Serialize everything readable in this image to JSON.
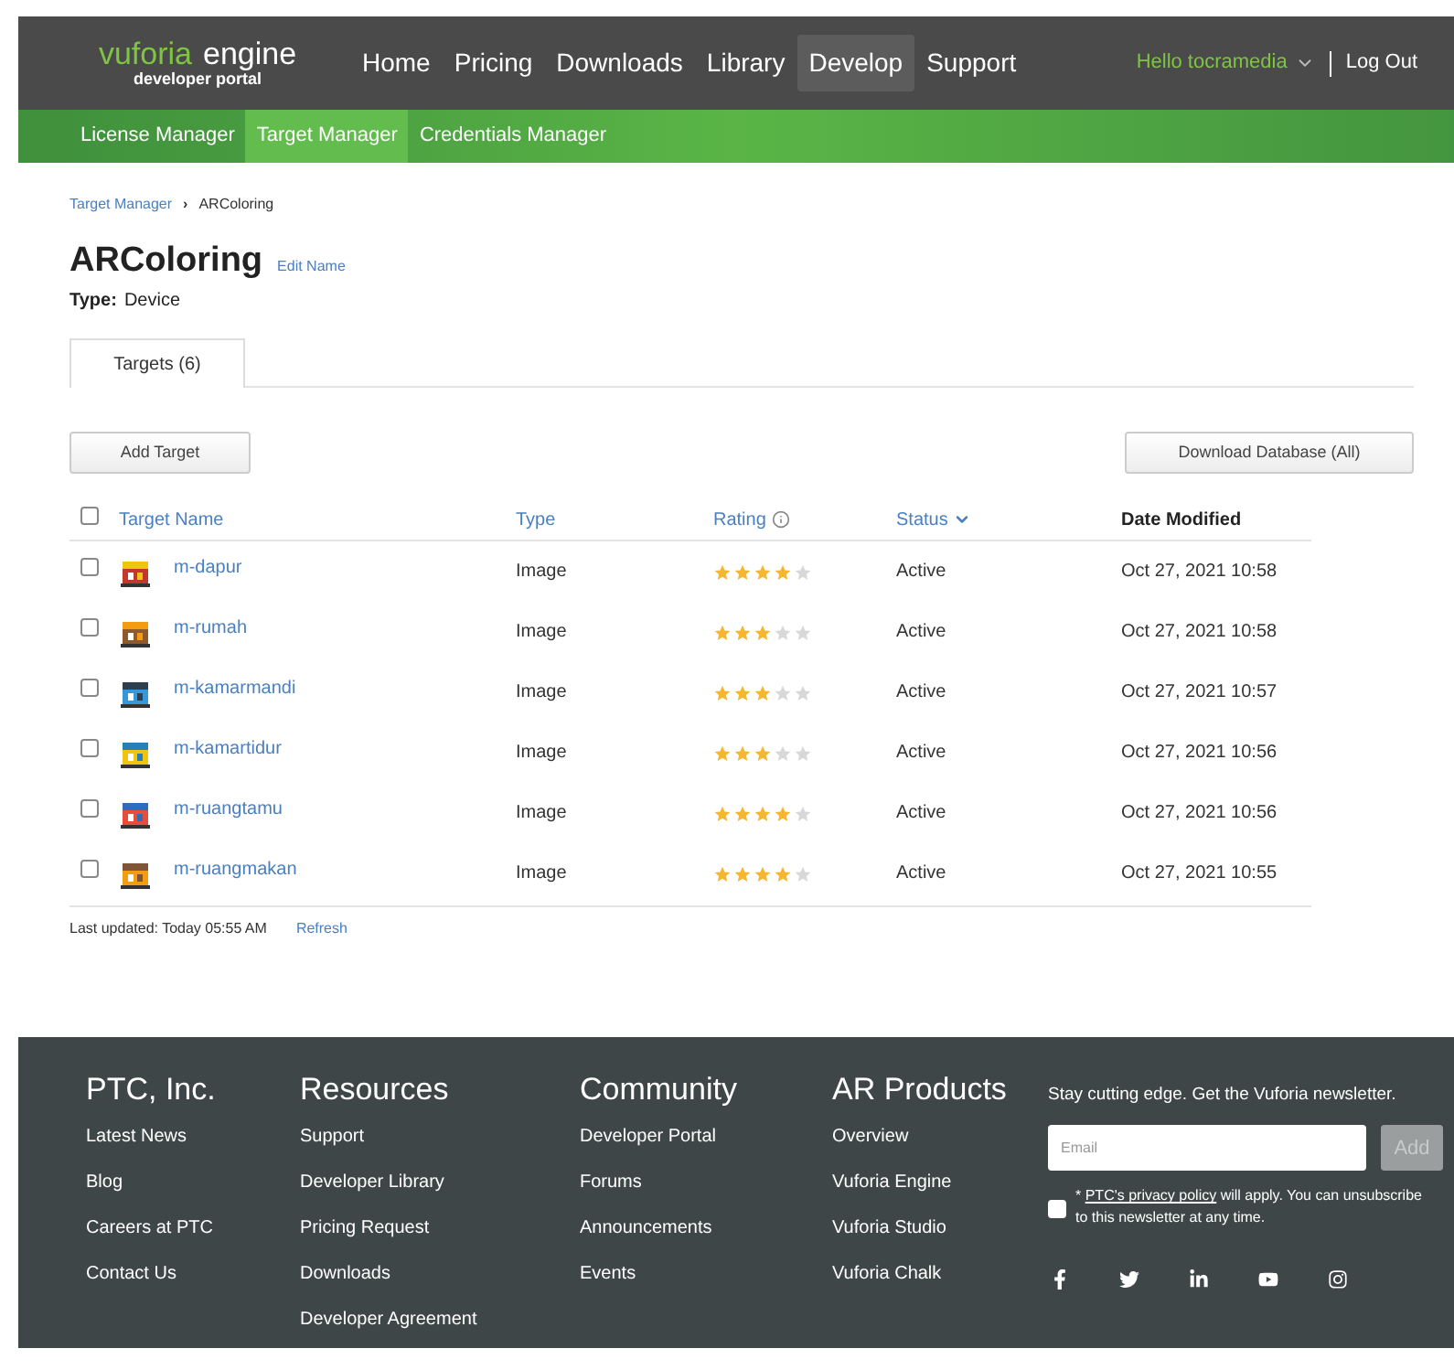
{
  "logo": {
    "word1": "vuforia",
    "word2": "engine",
    "subtitle": "developer portal"
  },
  "nav": [
    {
      "label": "Home",
      "selected": false
    },
    {
      "label": "Pricing",
      "selected": false
    },
    {
      "label": "Downloads",
      "selected": false
    },
    {
      "label": "Library",
      "selected": false
    },
    {
      "label": "Develop",
      "selected": true
    },
    {
      "label": "Support",
      "selected": false
    }
  ],
  "user": {
    "greeting": "Hello tocramedia",
    "logout": "Log Out"
  },
  "subnav": [
    {
      "label": "License Manager",
      "selected": false
    },
    {
      "label": "Target Manager",
      "selected": true
    },
    {
      "label": "Credentials Manager",
      "selected": false
    }
  ],
  "breadcrumb": {
    "link": "Target Manager",
    "separator": "›",
    "current": "ARColoring"
  },
  "database": {
    "name": "ARColoring",
    "edit": "Edit Name",
    "type_label": "Type:",
    "type": "Device"
  },
  "tabs": [
    {
      "label": "Targets (6)",
      "selected": true
    }
  ],
  "buttons": {
    "add": "Add Target",
    "download": "Download Database (All)"
  },
  "table": {
    "columns": [
      {
        "label": "Target Name",
        "kind": "link"
      },
      {
        "label": "Type",
        "kind": "link"
      },
      {
        "label": "Rating",
        "kind": "info"
      },
      {
        "label": "Status",
        "kind": "sort"
      },
      {
        "label": "Date Modified",
        "kind": "plain"
      }
    ],
    "rows": [
      {
        "checked": false,
        "name": "m-dapur",
        "type": "Image",
        "stars": 4,
        "status": "Active",
        "date": "Oct 27, 2021 10:58"
      },
      {
        "checked": false,
        "name": "m-rumah",
        "type": "Image",
        "stars": 3,
        "status": "Active",
        "date": "Oct 27, 2021 10:58"
      },
      {
        "checked": false,
        "name": "m-kamarmandi",
        "type": "Image",
        "stars": 3,
        "status": "Active",
        "date": "Oct 27, 2021 10:57"
      },
      {
        "checked": false,
        "name": "m-kamartidur",
        "type": "Image",
        "stars": 3,
        "status": "Active",
        "date": "Oct 27, 2021 10:56"
      },
      {
        "checked": false,
        "name": "m-ruangtamu",
        "type": "Image",
        "stars": 4,
        "status": "Active",
        "date": "Oct 27, 2021 10:56"
      },
      {
        "checked": false,
        "name": "m-ruangmakan",
        "type": "Image",
        "stars": 4,
        "status": "Active",
        "date": "Oct 27, 2021 10:55"
      }
    ],
    "all_checked": false
  },
  "updated": {
    "text": "Last updated: Today 05:55 AM",
    "refresh": "Refresh"
  },
  "footer": {
    "columns": [
      {
        "title": "PTC, Inc.",
        "links": [
          "Latest News",
          "Blog",
          "Careers at PTC",
          "Contact Us"
        ]
      },
      {
        "title": "Resources",
        "links": [
          "Support",
          "Developer Library",
          "Pricing Request",
          "Downloads",
          "Developer Agreement"
        ]
      },
      {
        "title": "Community",
        "links": [
          "Developer Portal",
          "Forums",
          "Announcements",
          "Events"
        ]
      },
      {
        "title": "AR Products",
        "links": [
          "Overview",
          "Vuforia Engine",
          "Vuforia Studio",
          "Vuforia Chalk"
        ]
      }
    ],
    "newsletter": {
      "heading": "Stay cutting edge. Get the Vuforia newsletter.",
      "placeholder": "Email",
      "button": "Add",
      "checked": false,
      "prefix": "* ",
      "policy": "PTC's privacy policy",
      "suffix": " will apply. You can unsubscribe to this newsletter at any time."
    },
    "social": [
      {
        "kind": "facebook"
      },
      {
        "kind": "twitter"
      },
      {
        "kind": "linkedin"
      },
      {
        "kind": "youtube"
      },
      {
        "kind": "instagram"
      }
    ]
  }
}
